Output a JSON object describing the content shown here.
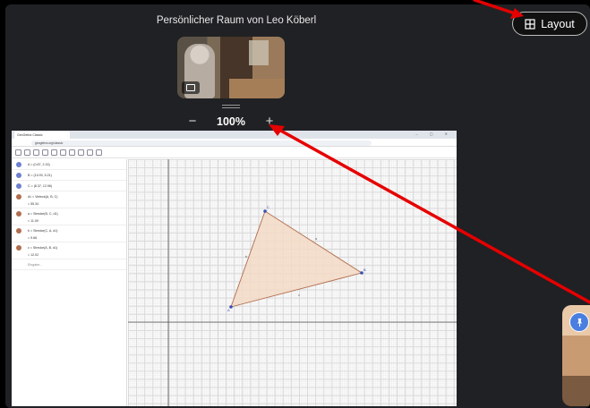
{
  "room": {
    "title": "Persönlicher Raum von Leo Köberl"
  },
  "header": {
    "layout_label": "Layout"
  },
  "zoom": {
    "minus": "−",
    "value": "100%",
    "plus": "+"
  },
  "share": {
    "browser_tab": "GeoGebra Classic",
    "url": "geogebra.org/classic",
    "algebra_rows": [
      {
        "text": "A = (0.87, 2.15)",
        "color": "#6c7fd0"
      },
      {
        "text": "B = (10.93, 5.21)",
        "color": "#6c7fd0"
      },
      {
        "text": "C = (8.37, 12.96)",
        "color": "#6c7fd0"
      },
      {
        "text": "d1 = Vieleck(A, B, C)",
        "sub": "= 55.34",
        "color": "#b06e4e"
      },
      {
        "text": "a = Strecke(B, C, d1)",
        "sub": "= 11.09",
        "color": "#b06e4e"
      },
      {
        "text": "b = Strecke(C, A, d1)",
        "sub": "= 9.66",
        "color": "#b06e4e"
      },
      {
        "text": "c = Strecke(A, B, d1)",
        "sub": "= 12.02",
        "color": "#b06e4e"
      }
    ],
    "input_placeholder": "Eingabe...",
    "labels": {
      "A": "A",
      "B": "B",
      "C": "C",
      "a": "a",
      "b": "b",
      "c": "c"
    },
    "triangle_fill": "#f3d9c6",
    "triangle_stroke": "#b06e4e",
    "point_color": "#3a4fb0"
  },
  "colors": {
    "annotation_arrow": "#e60000",
    "pin_badge": "#4a7ee0"
  },
  "icons": {
    "layout": "grid-icon",
    "pin": "pin-icon",
    "camera": "camera-icon"
  }
}
